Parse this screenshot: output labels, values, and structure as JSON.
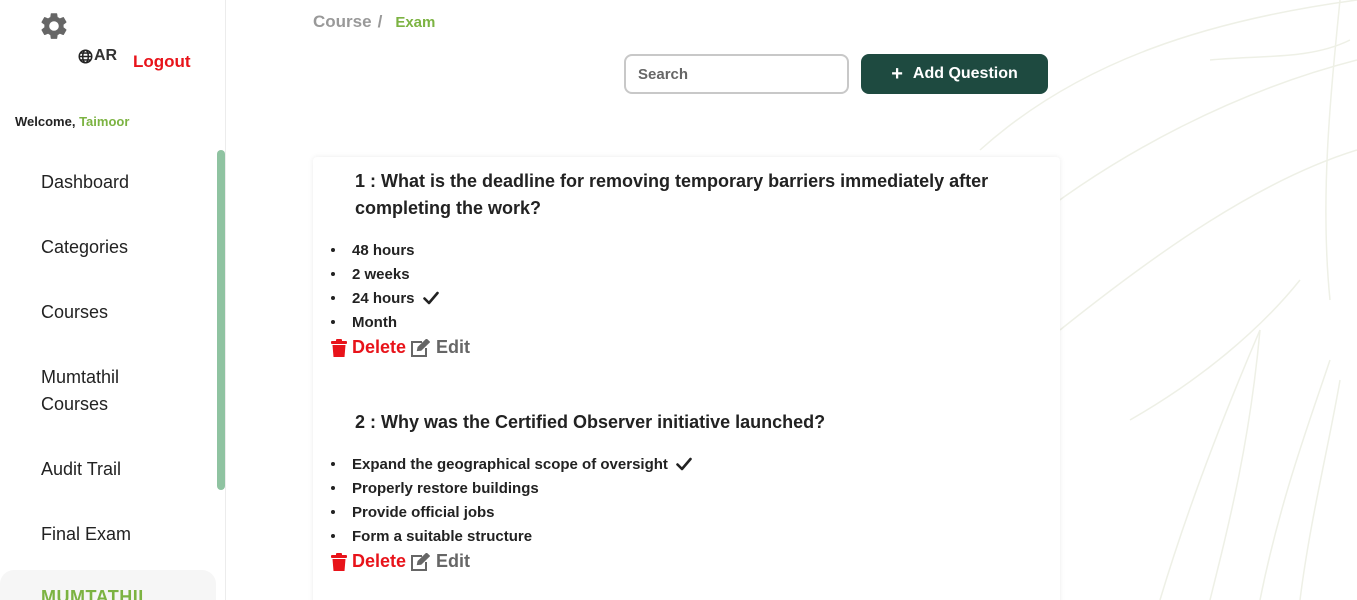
{
  "sidebar": {
    "settings_icon": "gear-icon",
    "language": {
      "icon": "globe-icon",
      "label": "AR"
    },
    "logout_label": "Logout",
    "welcome": {
      "prefix": "Welcome,",
      "user": "Taimoor"
    },
    "items": [
      {
        "label": "Dashboard"
      },
      {
        "label": "Categories"
      },
      {
        "label": "Courses"
      },
      {
        "label": "Mumtathil Courses"
      },
      {
        "label": "Audit Trail"
      },
      {
        "label": "Final Exam"
      },
      {
        "label": "MUMTATHIL"
      }
    ]
  },
  "breadcrumb": {
    "course": "Course",
    "separator": "/",
    "current": "Exam"
  },
  "search": {
    "placeholder": "Search"
  },
  "add_button": {
    "label": "Add Question",
    "icon": "plus-icon"
  },
  "colors": {
    "accent_green": "#7cb342",
    "primary_dark": "#1e4a40",
    "danger": "#e8131a",
    "scroll": "#8fc3a1"
  },
  "questions": [
    {
      "title": "1 : What is the deadline for removing temporary barriers immediately after completing the work?",
      "options": [
        {
          "text": "48 hours",
          "correct": false
        },
        {
          "text": "2 weeks",
          "correct": false
        },
        {
          "text": "24 hours",
          "correct": true
        },
        {
          "text": "Month",
          "correct": false
        }
      ],
      "delete_label": "Delete",
      "edit_label": "Edit"
    },
    {
      "title": "2 : Why was the Certified Observer initiative launched?",
      "options": [
        {
          "text": "Expand the geographical scope of oversight",
          "correct": true
        },
        {
          "text": "Properly restore buildings",
          "correct": false
        },
        {
          "text": "Provide official jobs",
          "correct": false
        },
        {
          "text": "Form a suitable structure",
          "correct": false
        }
      ],
      "delete_label": "Delete",
      "edit_label": "Edit"
    }
  ]
}
